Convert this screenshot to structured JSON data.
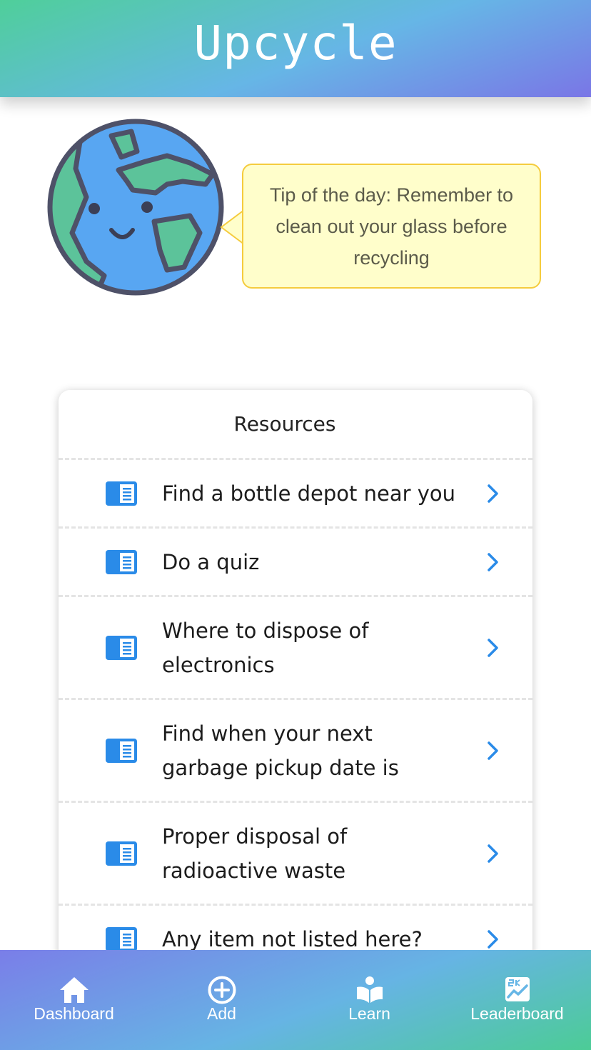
{
  "header": {
    "title": "Upcycle"
  },
  "tip": {
    "text": "Tip of the day: Remember to clean out your glass before recycling"
  },
  "resources": {
    "title": "Resources",
    "items": [
      {
        "label": "Find a bottle depot near you"
      },
      {
        "label": "Do a quiz"
      },
      {
        "label": "Where to dispose of electronics"
      },
      {
        "label": "Find when your next garbage pickup date is"
      },
      {
        "label": "Proper disposal of radioactive waste"
      },
      {
        "label": "Any item not listed here?"
      }
    ]
  },
  "nav": {
    "items": [
      {
        "label": "Dashboard",
        "icon": "home-icon"
      },
      {
        "label": "Add",
        "icon": "plus-circle-icon"
      },
      {
        "label": "Learn",
        "icon": "book-reader-icon"
      },
      {
        "label": "Leaderboard",
        "icon": "leaderboard-icon"
      }
    ]
  },
  "colors": {
    "accent": "#2a8be8",
    "tip_bg": "#fffecb",
    "tip_border": "#f5cc3e",
    "globe_ocean": "#58a6f2",
    "globe_land": "#5cc39a",
    "globe_outline": "#4e5168"
  }
}
